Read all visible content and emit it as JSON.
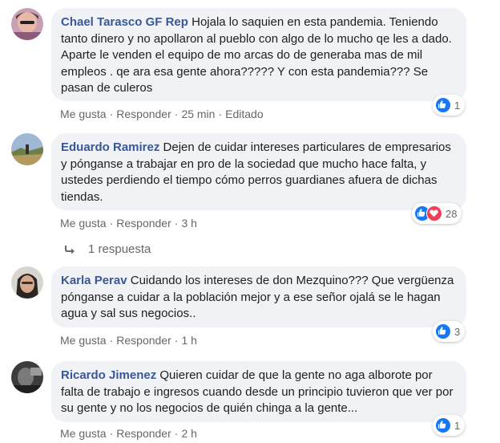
{
  "comments": [
    {
      "author": "Chael Tarasco GF Rep",
      "text": "Hojala lo saquien en esta pandemia. Teniendo tanto dinero y no apollaron al pueblo con algo de lo mucho qe les a dado. Aparte le venden el equipo de mo arcas do de generaba mas de mil empleos . qe ara esa gente ahora????? Y con esta pandemia??? Se pasan de culeros",
      "like": "Me gusta",
      "reply": "Responder",
      "time": "25 min",
      "edited": "Editado",
      "reaction_count": "1"
    },
    {
      "author": "Eduardo Ramirez",
      "text": "Dejen de cuidar intereses particulares de empresarios y pónganse a trabajar en pro de la sociedad que mucho hace falta, y ustedes perdiendo el tiempo cómo perros guardianes afuera de dichas tiendas.",
      "like": "Me gusta",
      "reply": "Responder",
      "time": "3 h",
      "reaction_count": "28",
      "replies_label": "1 respuesta"
    },
    {
      "author": "Karla Perav",
      "text": "Cuidando los intereses de don Mezquino??? Que vergüenza pónganse a cuidar a la población mejor y a ese señor ojalá se le hagan agua y sal sus negocios..",
      "like": "Me gusta",
      "reply": "Responder",
      "time": "1 h",
      "reaction_count": "3"
    },
    {
      "author": "Ricardo Jimenez",
      "text": "Quieren cuidar de que la gente no aga alborote por falta de trabajo e ingresos cuando desde un principio tuvieron que ver por su gente y no los negocios de quién chinga a la gente...",
      "like": "Me gusta",
      "reply": "Responder",
      "time": "2 h",
      "reaction_count": "1"
    }
  ],
  "colors": {
    "author": "#385898",
    "bubble": "#f0f2f5",
    "meta": "#65676b",
    "like": "#1877f2",
    "love": "#f33e58"
  },
  "icons": {
    "like": "thumbs-up-icon",
    "love": "heart-icon",
    "reply_arrow": "reply-arrow-icon"
  }
}
